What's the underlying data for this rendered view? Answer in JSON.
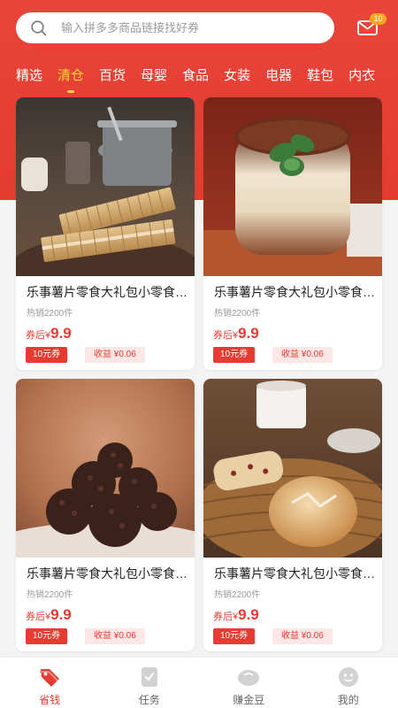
{
  "search": {
    "placeholder": "输入拼多多商品链接找好券"
  },
  "mail": {
    "badge": "10"
  },
  "tabs": [
    {
      "label": "精选",
      "active": false
    },
    {
      "label": "清仓",
      "active": true
    },
    {
      "label": "百货",
      "active": false
    },
    {
      "label": "母婴",
      "active": false
    },
    {
      "label": "食品",
      "active": false
    },
    {
      "label": "女装",
      "active": false
    },
    {
      "label": "电器",
      "active": false
    },
    {
      "label": "鞋包",
      "active": false
    },
    {
      "label": "内衣",
      "active": false
    }
  ],
  "products": [
    {
      "title": "乐事薯片零食大礼包小零食组合",
      "sold": "热销2200件",
      "price_prefix": "券后",
      "currency": "¥",
      "price": "9.9",
      "coupon": "10元券",
      "earn": "收益 ¥0.06",
      "image": "wafer-cookies"
    },
    {
      "title": "乐事薯片零食大礼包小零食组合",
      "sold": "热销2200件",
      "price_prefix": "券后",
      "currency": "¥",
      "price": "9.9",
      "coupon": "10元券",
      "earn": "收益 ¥0.06",
      "image": "tiramisu-jar"
    },
    {
      "title": "乐事薯片零食大礼包小零食组合",
      "sold": "热销2200件",
      "price_prefix": "券后",
      "currency": "¥",
      "price": "9.9",
      "coupon": "10元券",
      "earn": "收益 ¥0.06",
      "image": "chocolate-cookies"
    },
    {
      "title": "乐事薯片零食大礼包小零食组合",
      "sold": "热销2200件",
      "price_prefix": "券后",
      "currency": "¥",
      "price": "9.9",
      "coupon": "10元券",
      "earn": "收益 ¥0.06",
      "image": "bread-basket"
    }
  ],
  "bottom_nav": [
    {
      "label": "省钱",
      "icon": "tag-icon",
      "active": true
    },
    {
      "label": "任务",
      "icon": "task-icon",
      "active": false
    },
    {
      "label": "赚金豆",
      "icon": "bean-icon",
      "active": false
    },
    {
      "label": "我的",
      "icon": "profile-icon",
      "active": false
    }
  ],
  "colors": {
    "brand": "#e53b31",
    "tab_active": "#ffd13a",
    "badge": "#f5a623"
  }
}
